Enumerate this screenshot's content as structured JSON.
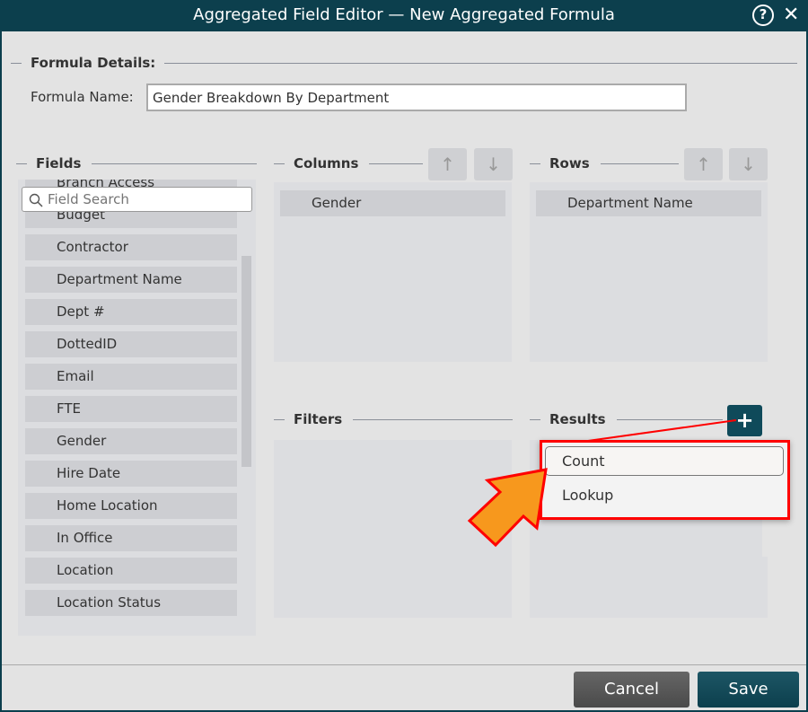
{
  "window": {
    "title": "Aggregated Field Editor — New Aggregated Formula",
    "help_icon": "question-circle-icon",
    "close_icon": "close-icon"
  },
  "details": {
    "section_label": "Formula Details:",
    "name_label": "Formula Name:",
    "name_value": "Gender Breakdown By Department"
  },
  "fields": {
    "section_label": "Fields",
    "search_placeholder": "Field Search",
    "items": [
      "Branch Access",
      "Budget",
      "Contractor",
      "Department Name",
      "Dept #",
      "DottedID",
      "Email",
      "FTE",
      "Gender",
      "Hire Date",
      "Home Location",
      "In Office",
      "Location",
      "Location Status"
    ]
  },
  "columns": {
    "section_label": "Columns",
    "items": [
      "Gender"
    ]
  },
  "rows": {
    "section_label": "Rows",
    "items": [
      "Department Name"
    ]
  },
  "filters": {
    "section_label": "Filters"
  },
  "results": {
    "section_label": "Results",
    "add_label": "+",
    "menu": [
      "Count",
      "Lookup"
    ]
  },
  "footer": {
    "cancel": "Cancel",
    "save": "Save"
  },
  "colors": {
    "header": "#0c3f4d",
    "highlight": "#ff0000",
    "callout_arrow": "#f7981d"
  }
}
